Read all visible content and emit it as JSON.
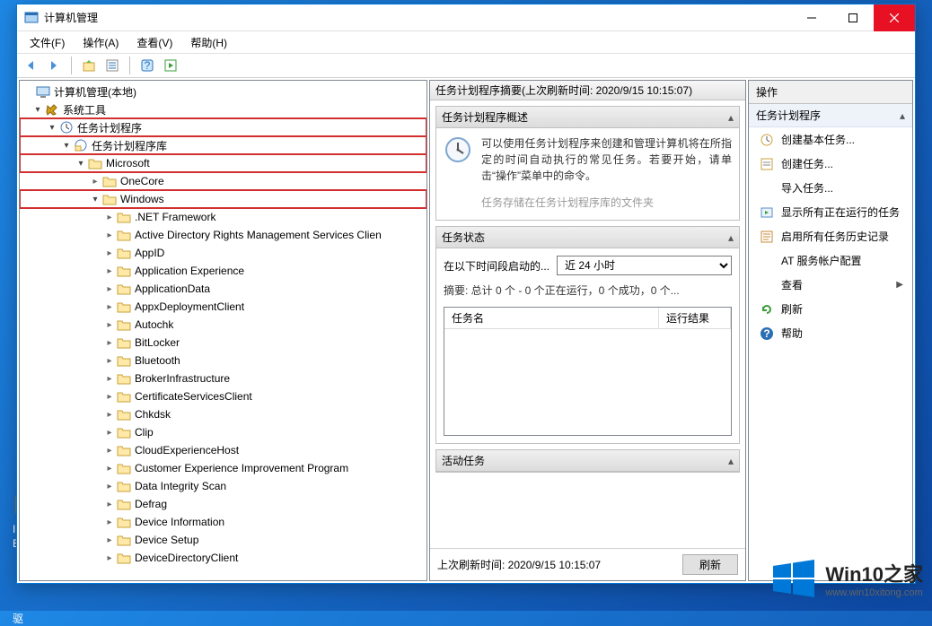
{
  "window": {
    "title": "计算机管理"
  },
  "menubar": [
    {
      "label": "文件(F)"
    },
    {
      "label": "操作(A)"
    },
    {
      "label": "查看(V)"
    },
    {
      "label": "帮助(H)"
    }
  ],
  "tree": {
    "root": "计算机管理(本地)",
    "sys_tools": "系统工具",
    "scheduler": "任务计划程序",
    "library": "任务计划程序库",
    "microsoft": "Microsoft",
    "onecore": "OneCore",
    "windows": "Windows",
    "items": [
      ".NET Framework",
      "Active Directory Rights Management Services Clien",
      "AppID",
      "Application Experience",
      "ApplicationData",
      "AppxDeploymentClient",
      "Autochk",
      "BitLocker",
      "Bluetooth",
      "BrokerInfrastructure",
      "CertificateServicesClient",
      "Chkdsk",
      "Clip",
      "CloudExperienceHost",
      "Customer Experience Improvement Program",
      "Data Integrity Scan",
      "Defrag",
      "Device Information",
      "Device Setup",
      "DeviceDirectoryClient"
    ]
  },
  "center": {
    "header": "任务计划程序摘要(上次刷新时间: 2020/9/15 10:15:07)",
    "overview_title": "任务计划程序概述",
    "overview_text": "可以使用任务计划程序来创建和管理计算机将在所指定的时间自动执行的常见任务。若要开始，请单击“操作”菜单中的命令。",
    "overview_cut": "任务存储在任务计划程序库的文件夹",
    "status_title": "任务状态",
    "status_label": "在以下时间段启动的...",
    "status_combo": "近 24 小时",
    "summary": "摘要: 总计 0 个 - 0 个正在运行，0 个成功，0 个...",
    "col_name": "任务名",
    "col_result": "运行结果",
    "active_title": "活动任务",
    "footer_label": "上次刷新时间: 2020/9/15 10:15:07",
    "refresh_btn": "刷新"
  },
  "actions": {
    "header": "操作",
    "group": "任务计划程序",
    "items": [
      {
        "icon": "clock",
        "label": "创建基本任务..."
      },
      {
        "icon": "task",
        "label": "创建任务..."
      },
      {
        "icon": "none",
        "label": "导入任务..."
      },
      {
        "icon": "running",
        "label": "显示所有正在运行的任务"
      },
      {
        "icon": "history",
        "label": "启用所有任务历史记录"
      },
      {
        "icon": "none",
        "label": "AT 服务帐户配置"
      },
      {
        "icon": "none",
        "label": "查看",
        "sub": true
      },
      {
        "icon": "refresh",
        "label": "刷新"
      },
      {
        "icon": "help",
        "label": "帮助"
      }
    ]
  },
  "watermark": {
    "big": "Win10之家",
    "small": "www.win10xitong.com"
  },
  "desktop": {
    "char1": "I",
    "char2": "E",
    "char3": "驱"
  }
}
